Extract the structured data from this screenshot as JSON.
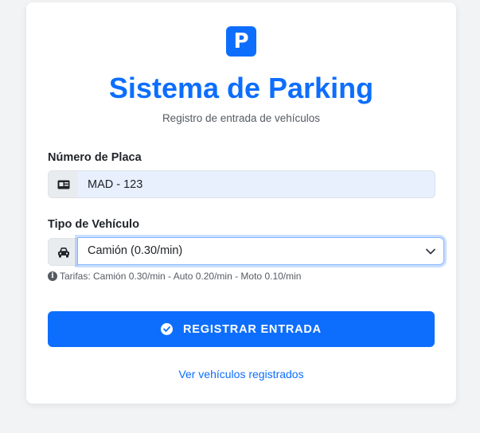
{
  "logo": {
    "letter": "P"
  },
  "header": {
    "title": "Sistema de Parking",
    "subtitle": "Registro de entrada de vehículos"
  },
  "form": {
    "plate": {
      "label": "Número de Placa",
      "value": "MAD - 123",
      "icon": "id-card-icon"
    },
    "vehicle_type": {
      "label": "Tipo de Vehículo",
      "selected": "Camión (0.30/min)",
      "icon": "car-icon"
    },
    "hint": "Tarifas: Camión 0.30/min - Auto 0.20/min - Moto 0.10/min",
    "submit_label": "REGISTRAR ENTRADA"
  },
  "footer": {
    "link_label": "Ver vehículos registrados"
  },
  "colors": {
    "primary": "#0d6efd",
    "background": "#f1f3f5",
    "autofill": "#e8f0fe"
  }
}
